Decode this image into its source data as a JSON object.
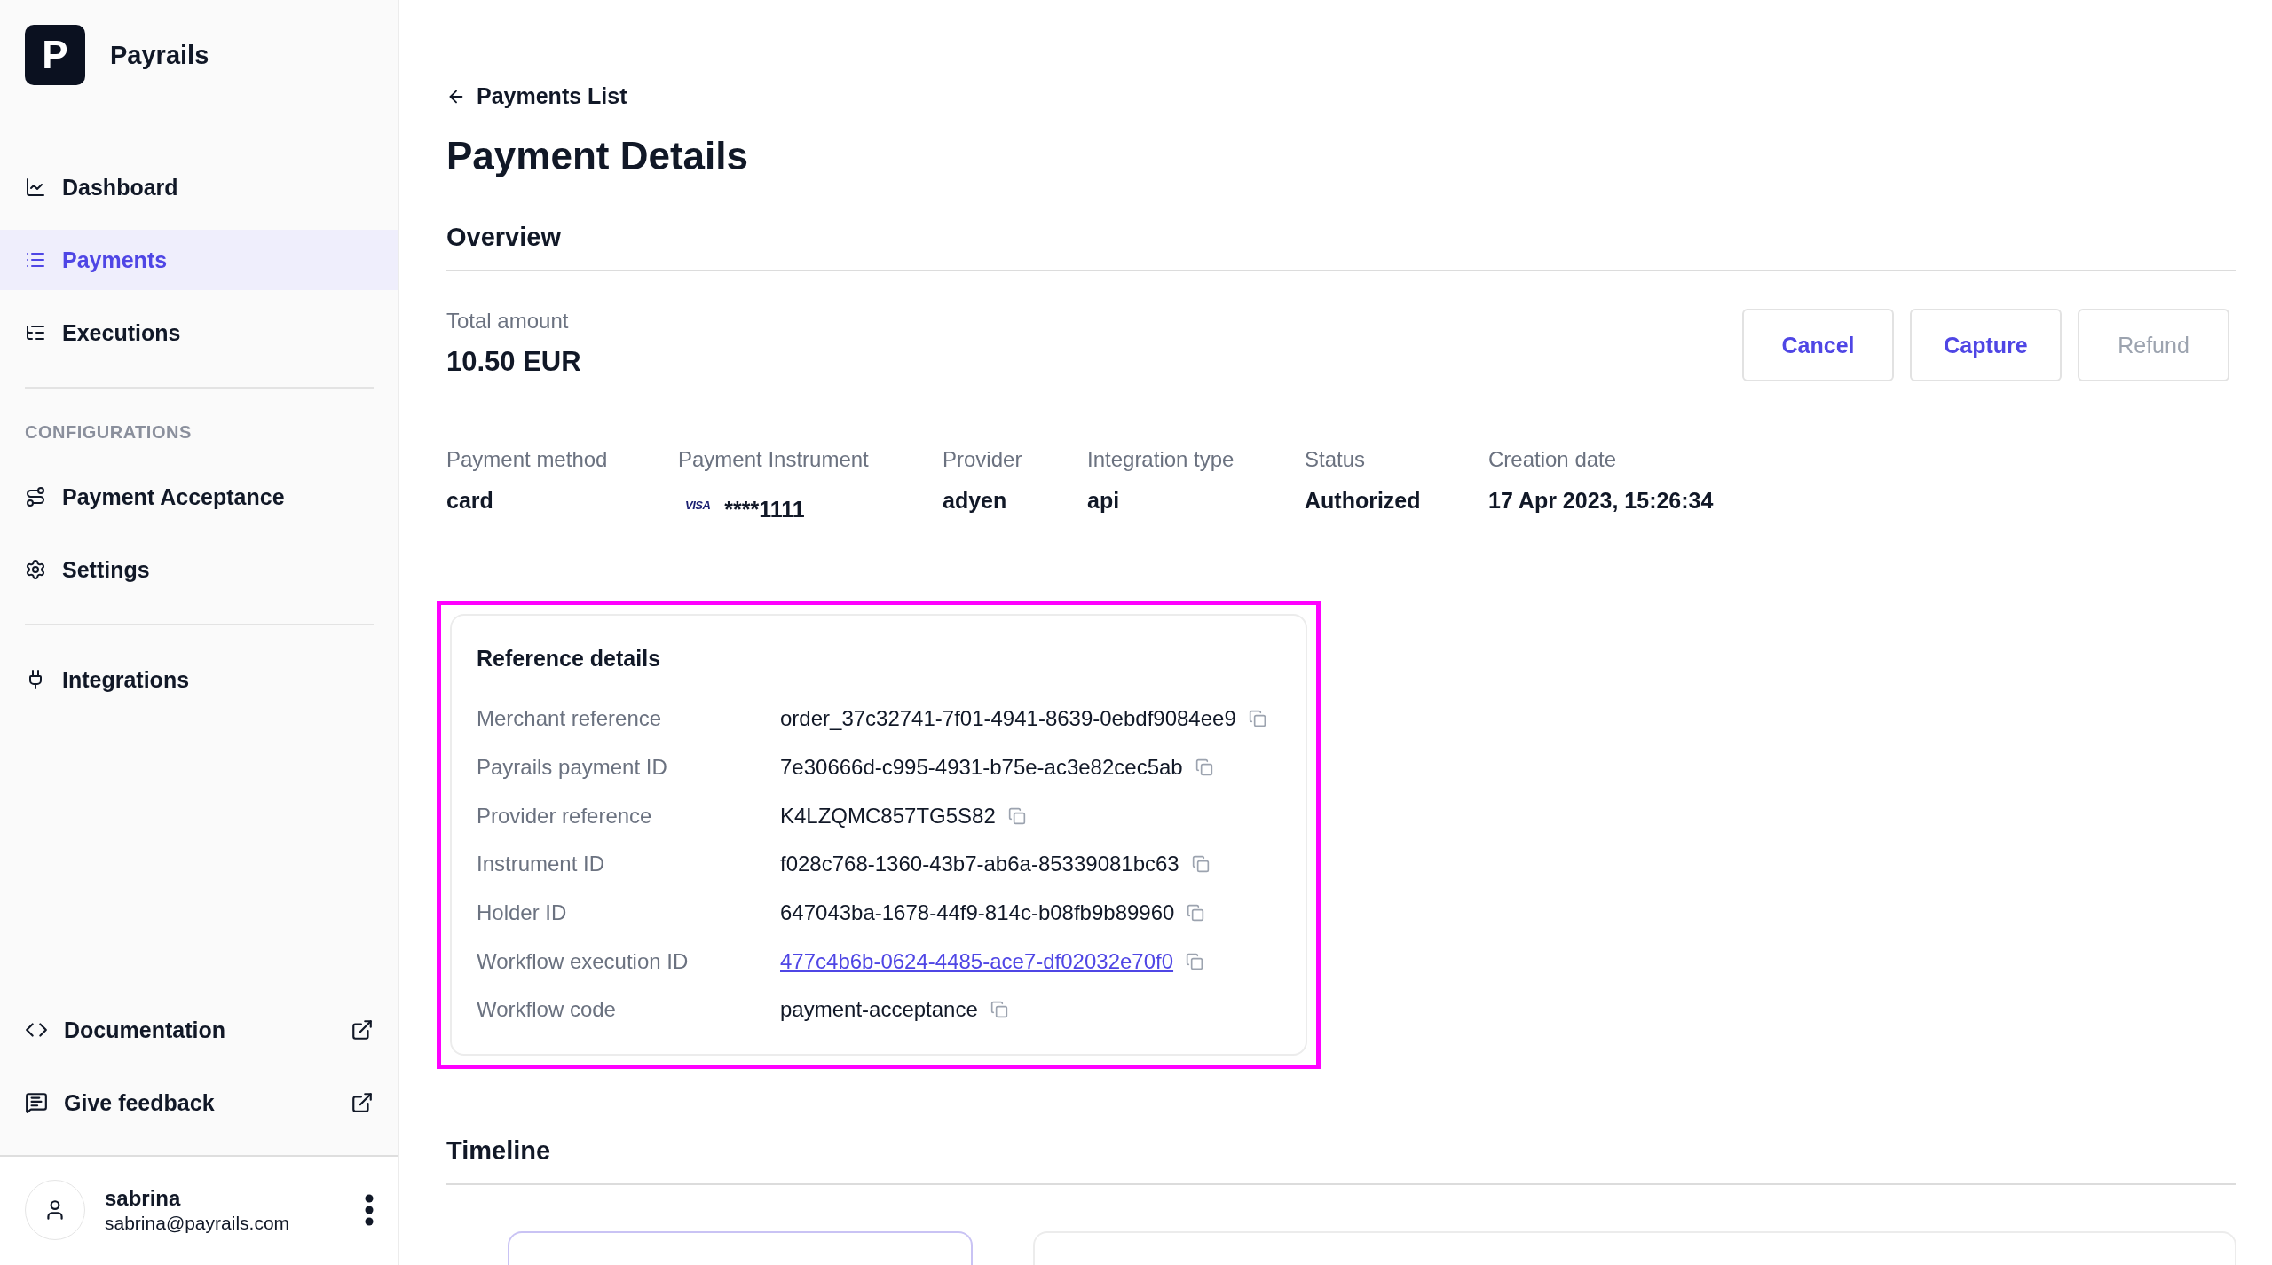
{
  "sidebar": {
    "brand": {
      "logo_letter": "P",
      "name": "Payrails"
    },
    "nav": [
      {
        "label": "Dashboard",
        "selected": false
      },
      {
        "label": "Payments",
        "selected": true
      },
      {
        "label": "Executions",
        "selected": false
      }
    ],
    "section_title": "CONFIGURATIONS",
    "config_nav": [
      {
        "label": "Payment Acceptance",
        "selected": false
      },
      {
        "label": "Settings",
        "selected": false
      }
    ],
    "extra_nav": [
      {
        "label": "Integrations",
        "selected": false
      }
    ],
    "external_links": [
      {
        "label": "Documentation"
      },
      {
        "label": "Give feedback"
      }
    ],
    "user": {
      "name": "sabrina",
      "email": "sabrina@payrails.com"
    }
  },
  "back_link": "Payments List",
  "title": "Payment Details",
  "overview": {
    "heading": "Overview",
    "total_label": "Total amount",
    "total_value": "10.50 EUR",
    "buttons": [
      {
        "label": "Cancel",
        "disabled": false
      },
      {
        "label": "Capture",
        "disabled": false
      },
      {
        "label": "Refund",
        "disabled": true
      }
    ],
    "fields": [
      {
        "label": "Payment method",
        "value": "card"
      },
      {
        "label": "Payment Instrument",
        "value": "****1111",
        "brand": "VISA"
      },
      {
        "label": "Provider",
        "value": "adyen"
      },
      {
        "label": "Integration type",
        "value": "api"
      },
      {
        "label": "Status",
        "value": "Authorized"
      },
      {
        "label": "Creation date",
        "value": "17 Apr 2023, 15:26:34"
      }
    ]
  },
  "reference_details": {
    "highlighted": true,
    "title": "Reference details",
    "rows": [
      {
        "label": "Merchant reference",
        "value": "order_37c32741-7f01-4941-8639-0ebdf9084ee9",
        "kind": "text"
      },
      {
        "label": "Payrails payment ID",
        "value": "7e30666d-c995-4931-b75e-ac3e82cec5ab",
        "kind": "text"
      },
      {
        "label": "Provider reference",
        "value": "K4LZQMC857TG5S82",
        "kind": "text"
      },
      {
        "label": "Instrument ID",
        "value": "f028c768-1360-43b7-ab6a-85339081bc63",
        "kind": "text"
      },
      {
        "label": "Holder ID",
        "value": "647043ba-1678-44f9-814c-b08fb9b89960",
        "kind": "text"
      },
      {
        "label": "Workflow execution ID",
        "value": "477c4b6b-0624-4485-ace7-df02032e70f0",
        "kind": "link"
      },
      {
        "label": "Workflow code",
        "value": "payment-acceptance",
        "kind": "text"
      }
    ]
  },
  "timeline": {
    "heading": "Timeline"
  }
}
